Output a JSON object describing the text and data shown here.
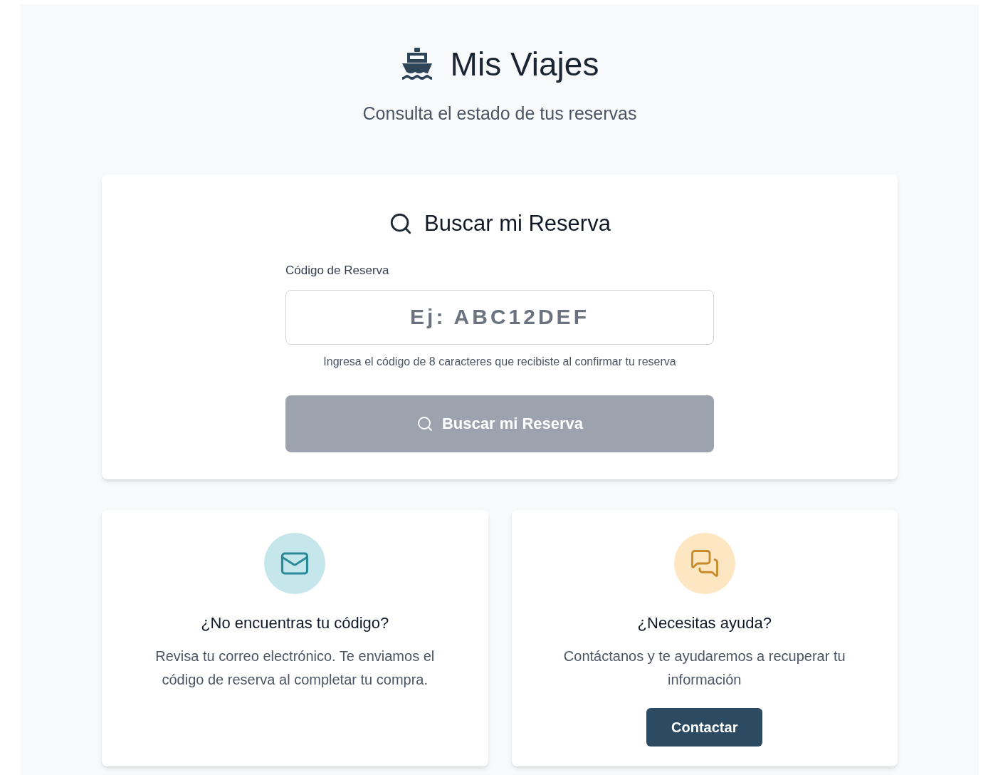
{
  "header": {
    "title": "Mis Viajes",
    "subtitle": "Consulta el estado de tus reservas"
  },
  "search_card": {
    "title": "Buscar mi Reserva",
    "field": {
      "label": "Código de Reserva",
      "placeholder": "Ej: ABC12DEF",
      "hint": "Ingresa el código de 8 caracteres que recibiste al confirmar tu reserva"
    },
    "button": {
      "label": "Buscar mi Reserva",
      "disabled": true
    }
  },
  "help_cards": [
    {
      "kind": "email",
      "color": "#c5e6ea",
      "title": "¿No encuentras tu código?",
      "text": "Revisa tu correo electrónico. Te enviamos el código de reserva al completar tu compra."
    },
    {
      "kind": "chat",
      "color": "#fde7c3",
      "title": "¿Necesitas ayuda?",
      "text": "Contáctanos y te ayudaremos a recuperar tu información",
      "button": "Contactar"
    }
  ]
}
